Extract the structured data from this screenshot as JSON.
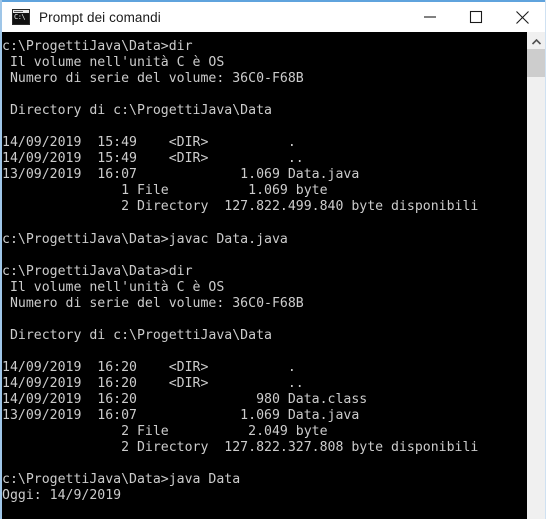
{
  "window": {
    "title": "Prompt dei comandi",
    "icon": "cmd-console-icon",
    "icon_text": "C:\\",
    "accent_color": "#5fa3dd",
    "background_color": "#ffffff"
  },
  "titlebar": {
    "minimize_label": "Riduci a icona",
    "maximize_label": "Ingrandisci",
    "close_label": "Chiudi"
  },
  "console": {
    "background_color": "#000000",
    "text_color": "#cccccc",
    "prompt": "c:\\ProgettiJava\\Data>",
    "lines": [
      "c:\\ProgettiJava\\Data>dir",
      " Il volume nell'unità C è OS",
      " Numero di serie del volume: 36C0-F68B",
      "",
      " Directory di c:\\ProgettiJava\\Data",
      "",
      "14/09/2019  15:49    <DIR>          .",
      "14/09/2019  15:49    <DIR>          ..",
      "13/09/2019  16:07             1.069 Data.java",
      "               1 File          1.069 byte",
      "               2 Directory  127.822.499.840 byte disponibili",
      "",
      "c:\\ProgettiJava\\Data>javac Data.java",
      "",
      "c:\\ProgettiJava\\Data>dir",
      " Il volume nell'unità C è OS",
      " Numero di serie del volume: 36C0-F68B",
      "",
      " Directory di c:\\ProgettiJava\\Data",
      "",
      "14/09/2019  16:20    <DIR>          .",
      "14/09/2019  16:20    <DIR>          ..",
      "14/09/2019  16:20               980 Data.class",
      "13/09/2019  16:07             1.069 Data.java",
      "               2 File          2.049 byte",
      "               2 Directory  127.822.327.808 byte disponibili",
      "",
      "c:\\ProgettiJava\\Data>java Data",
      "Oggi: 14/9/2019"
    ],
    "commands": [
      "dir",
      "javac Data.java",
      "dir",
      "java Data"
    ],
    "volume_label": "OS",
    "volume_serial": "36C0-F68B",
    "directory_path": "c:\\ProgettiJava\\Data",
    "first_listing": {
      "entries": [
        {
          "date": "14/09/2019",
          "time": "15:49",
          "type": "<DIR>",
          "size": "",
          "name": "."
        },
        {
          "date": "14/09/2019",
          "time": "15:49",
          "type": "<DIR>",
          "size": "",
          "name": ".."
        },
        {
          "date": "13/09/2019",
          "time": "16:07",
          "type": "",
          "size": "1.069",
          "name": "Data.java"
        }
      ],
      "file_count": "1",
      "file_bytes": "1.069",
      "dir_count": "2",
      "free_bytes": "127.822.499.840"
    },
    "second_listing": {
      "entries": [
        {
          "date": "14/09/2019",
          "time": "16:20",
          "type": "<DIR>",
          "size": "",
          "name": "."
        },
        {
          "date": "14/09/2019",
          "time": "16:20",
          "type": "<DIR>",
          "size": "",
          "name": ".."
        },
        {
          "date": "14/09/2019",
          "time": "16:20",
          "type": "",
          "size": "980",
          "name": "Data.class"
        },
        {
          "date": "13/09/2019",
          "time": "16:07",
          "type": "",
          "size": "1.069",
          "name": "Data.java"
        }
      ],
      "file_count": "2",
      "file_bytes": "2.049",
      "dir_count": "2",
      "free_bytes": "127.822.327.808"
    },
    "program_output": "Oggi: 14/9/2019"
  },
  "scrollbar": {
    "orientation": "vertical",
    "up_arrow": "▲",
    "thumb_color": "#cdcdcd",
    "track_color": "#f0f0f0"
  }
}
